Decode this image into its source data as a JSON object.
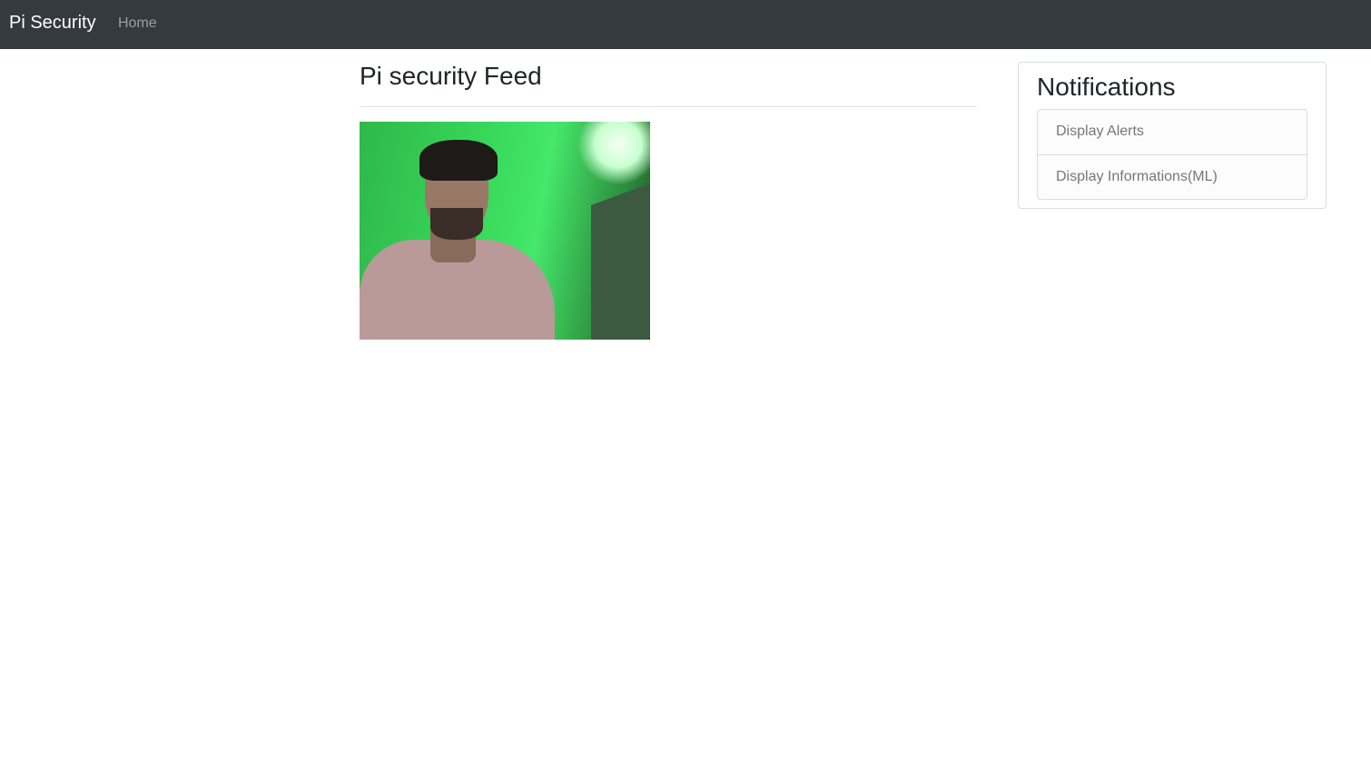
{
  "navbar": {
    "brand": "Pi Security",
    "links": [
      {
        "label": "Home"
      }
    ]
  },
  "main": {
    "title": "Pi security Feed",
    "feed": {
      "alt": "camera-feed"
    }
  },
  "notifications": {
    "title": "Notifications",
    "items": [
      {
        "label": "Display Alerts"
      },
      {
        "label": "Display Informations(ML)"
      }
    ]
  },
  "colors": {
    "navbar_bg": "#343a40"
  }
}
